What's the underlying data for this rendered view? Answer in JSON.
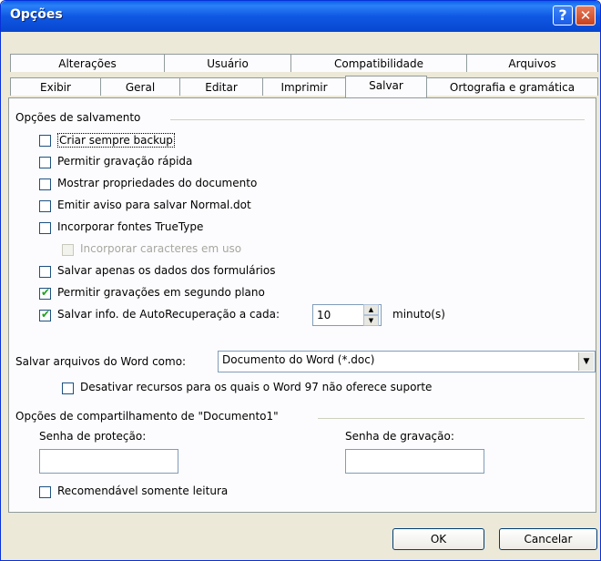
{
  "window": {
    "title": "Opções"
  },
  "titlebar": {
    "help_label": "?",
    "close_label": "✕"
  },
  "tabs": {
    "row1": [
      "Alterações",
      "Usuário",
      "Compatibilidade",
      "Arquivos"
    ],
    "row2": [
      "Exibir",
      "Geral",
      "Editar",
      "Imprimir",
      "Salvar",
      "Ortografia e gramática"
    ],
    "active": "Salvar"
  },
  "save_options": {
    "title": "Opções de salvamento",
    "items": [
      {
        "label": "Criar sempre backup",
        "checked": false
      },
      {
        "label": "Permitir gravação rápida",
        "checked": false
      },
      {
        "label": "Mostrar propriedades do documento",
        "checked": false
      },
      {
        "label": "Emitir aviso para salvar Normal.dot",
        "checked": false
      },
      {
        "label": "Incorporar fontes TrueType",
        "checked": false
      },
      {
        "label": "Incorporar caracteres em uso",
        "checked": false
      },
      {
        "label": "Salvar apenas os dados dos formulários",
        "checked": false
      },
      {
        "label": "Permitir gravações em segundo plano",
        "checked": true
      },
      {
        "label": "Salvar info. de AutoRecuperação a cada:",
        "checked": true
      }
    ],
    "autorecover_minutes": "10",
    "minutes_label": "minuto(s)"
  },
  "save_as": {
    "label": "Salvar arquivos do Word como:",
    "value": "Documento do Word (*.doc)",
    "disable_label": "Desativar recursos para os quais o Word 97 não oferece suporte",
    "disable_checked": false
  },
  "sharing": {
    "title": "Opções de compartilhamento de \"Documento1\"",
    "password_open_label": "Senha de proteção:",
    "password_modify_label": "Senha de gravação:",
    "password_open_value": "",
    "password_modify_value": "",
    "readonly_label": "Recomendável somente leitura",
    "readonly_checked": false
  },
  "footer": {
    "ok_label": "OK",
    "cancel_label": "Cancelar"
  }
}
